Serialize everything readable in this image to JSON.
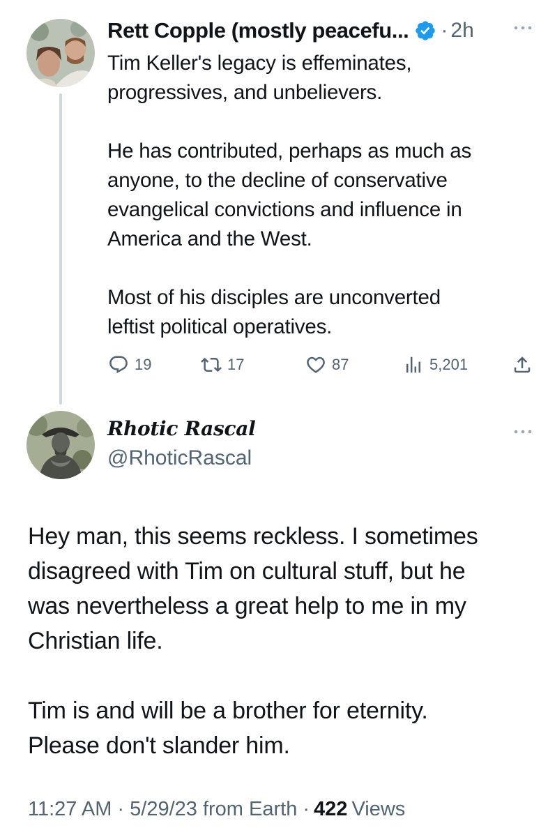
{
  "parent_tweet": {
    "author_name": "Rett Copple (mostly peacefu...",
    "separator": "·",
    "time_ago": "2h",
    "body": "Tim Keller's legacy is effeminates,\nprogressives, and unbelievers.\n\nHe has contributed, perhaps as much as\nanyone, to the decline of conservative\nevangelical convictions and influence in\nAmerica and the West.\n\nMost of his disciples are unconverted\nleftist political operatives.",
    "replies": "19",
    "retweets": "17",
    "likes": "87",
    "views": "5,201",
    "icons": {
      "verified": "verified-badge-icon",
      "reply": "reply-icon",
      "retweet": "retweet-icon",
      "like": "heart-icon",
      "views": "views-bar-chart-icon",
      "share": "share-icon",
      "more": "more-dots-icon"
    }
  },
  "reply_tweet": {
    "author_name": "Rhotic Rascal",
    "handle": "@RhoticRascal",
    "body": "Hey man, this seems reckless. I sometimes\ndisagreed with Tim on cultural stuff, but he\nwas nevertheless a great help to me in my\nChristian life.\n\nTim is and will be a brother for eternity.\nPlease don't slander him.",
    "meta_prefix": "11:27 AM · 5/29/23 from Earth ·",
    "views_count": "422",
    "views_label": "Views"
  },
  "colors": {
    "text_primary": "#0f1419",
    "text_secondary": "#536471",
    "verified_blue": "#1d9bf0",
    "thread_line": "#cfd9de"
  }
}
